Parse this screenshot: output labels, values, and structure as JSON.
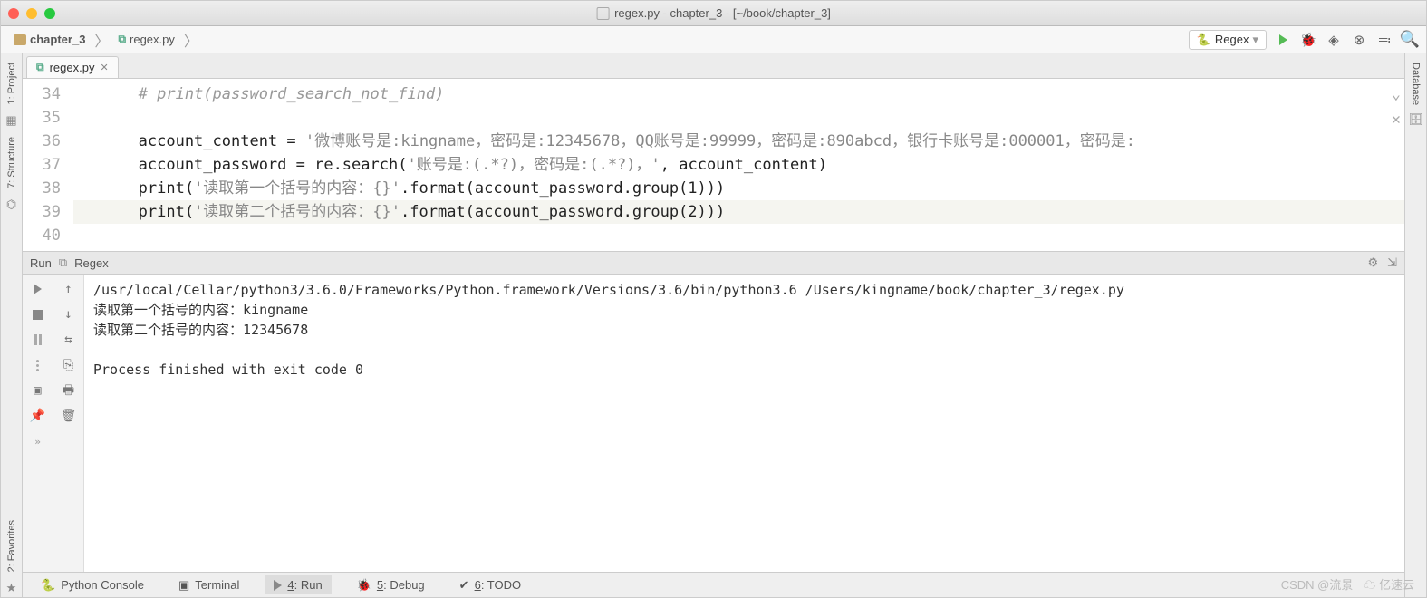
{
  "title": "regex.py - chapter_3 - [~/book/chapter_3]",
  "breadcrumbs": {
    "dir": "chapter_3",
    "file": "regex.py"
  },
  "run_config": {
    "label": "Regex"
  },
  "tabs": [
    {
      "label": "regex.py"
    }
  ],
  "sidebar_left": {
    "project": "1: Project",
    "structure": "7: Structure",
    "favorites": "2: Favorites"
  },
  "sidebar_right": {
    "database": "Database"
  },
  "editor": {
    "lines": [
      {
        "n": "34",
        "indent": "       ",
        "comment": "# print(password_search_not_find)"
      },
      {
        "n": "35",
        "text": ""
      },
      {
        "n": "36",
        "text": "       account_content = ",
        "str": "'微博账号是:kingname，密码是:12345678，QQ账号是:99999，密码是:890abcd，银行卡账号是:000001，密码是:"
      },
      {
        "n": "37",
        "text": "       account_password = re.search(",
        "str": "'账号是:(.*?)，密码是:(.*?)，'",
        "tail": ", account_content)"
      },
      {
        "n": "38",
        "text": "       print(",
        "str": "'读取第一个括号的内容：{}'",
        "tail": ".format(account_password.group(1)))"
      },
      {
        "n": "39",
        "hl": true,
        "text": "       print(",
        "str": "'读取第二个括号的内容：{}'",
        "tail": ".format(account_password.group(2)))"
      },
      {
        "n": "40",
        "text": ""
      }
    ]
  },
  "run_panel": {
    "title_left": "Run",
    "title_name": "Regex",
    "output": [
      "/usr/local/Cellar/python3/3.6.0/Frameworks/Python.framework/Versions/3.6/bin/python3.6 /Users/kingname/book/chapter_3/regex.py",
      "读取第一个括号的内容：kingname",
      "读取第二个括号的内容：12345678",
      "",
      "Process finished with exit code 0"
    ]
  },
  "bottom": {
    "python_console": "Python Console",
    "terminal": "Terminal",
    "run": "4: Run",
    "debug": "5: Debug",
    "todo": "6: TODO"
  },
  "watermark": {
    "csdn": "CSDN @流景",
    "yisu": "亿速云"
  }
}
